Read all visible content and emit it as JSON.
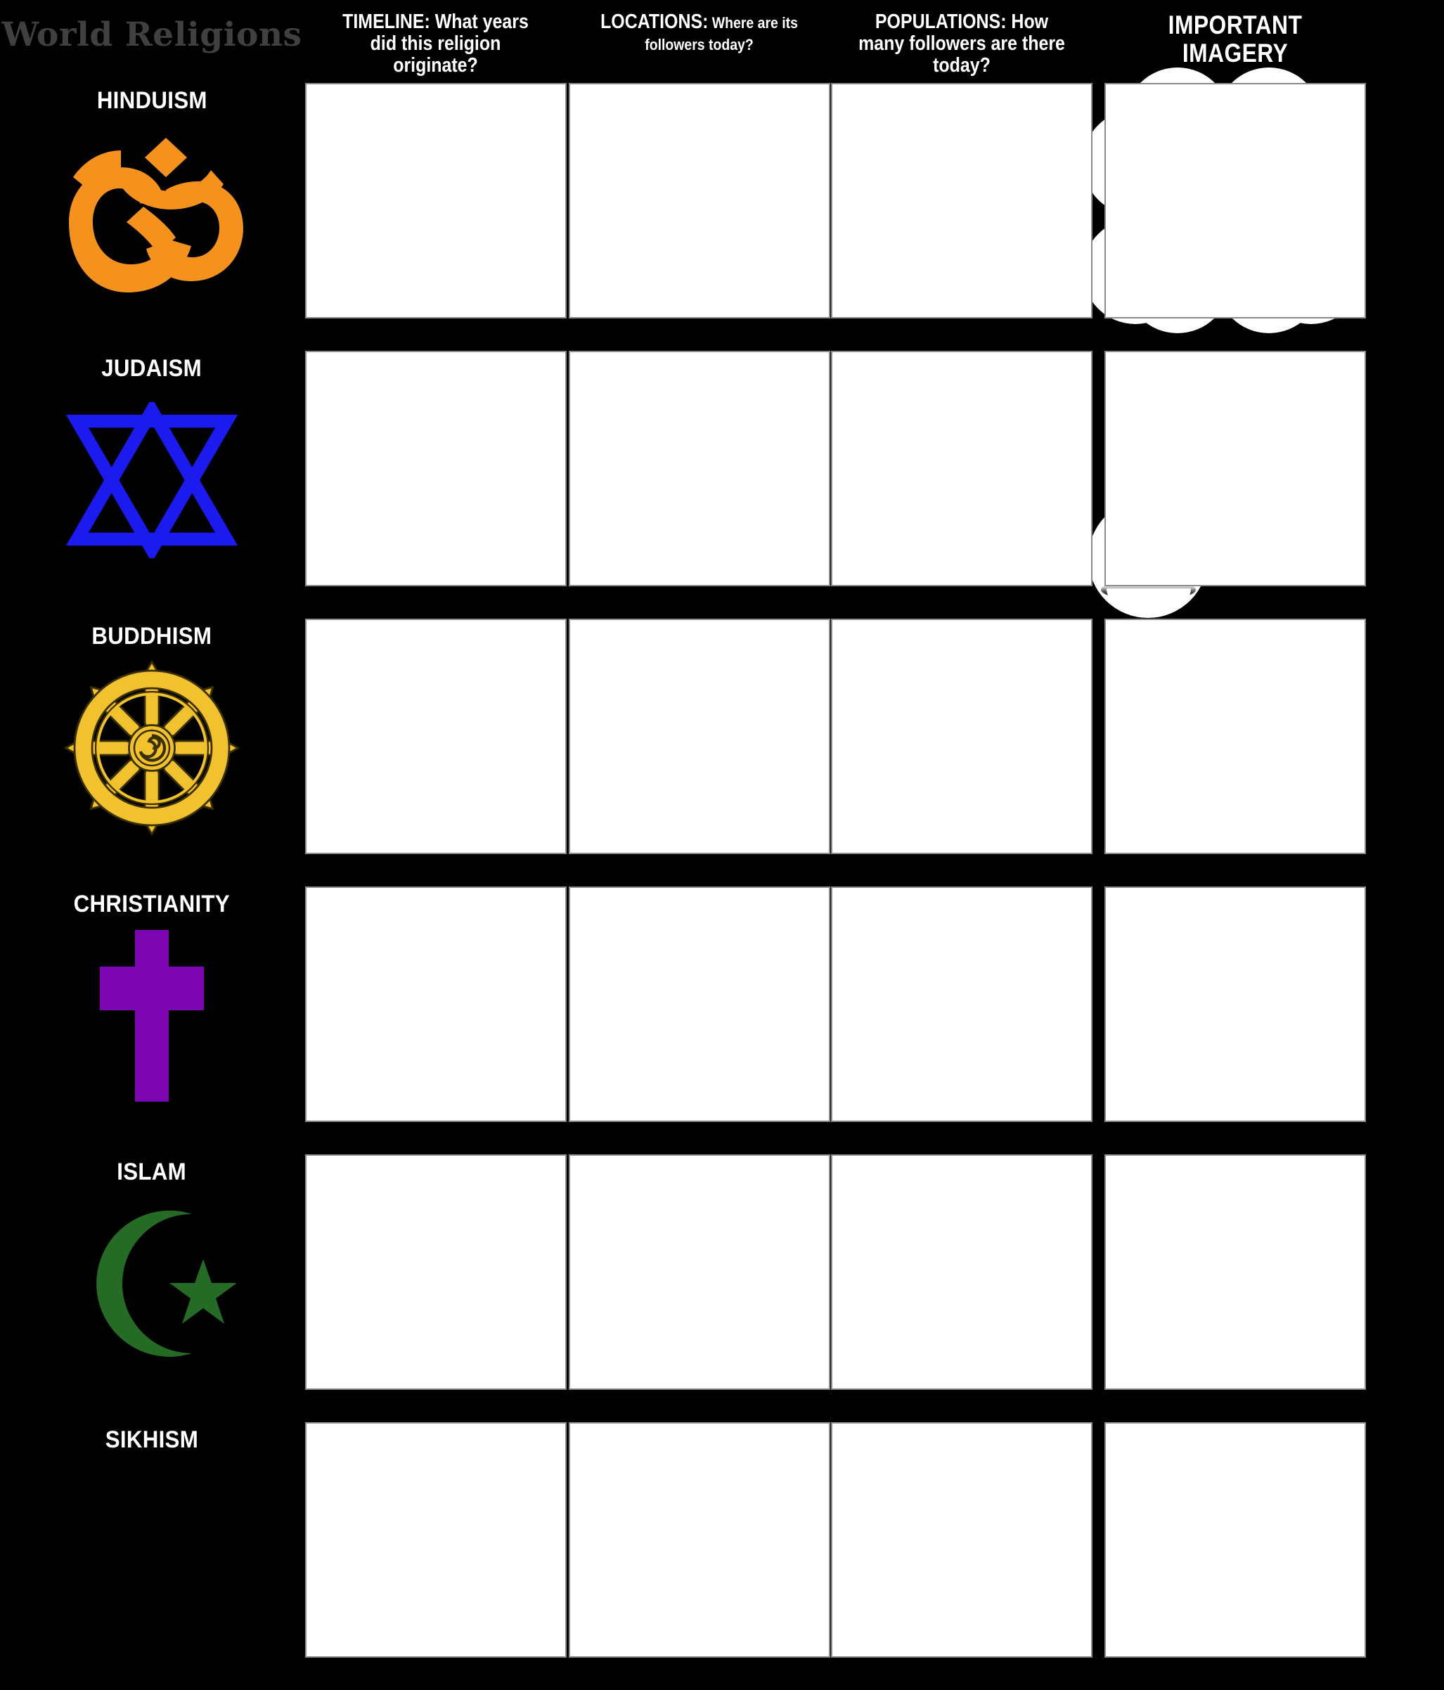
{
  "board": {
    "title": "World Religions",
    "title_color": "#3f403f",
    "background": "#000000",
    "cell_fill": "#ffffff",
    "cell_border": "#8c8c8c"
  },
  "columns": [
    {
      "id": "timeline",
      "lead": "TIMELINE:",
      "tail": " What years did this religion originate?"
    },
    {
      "id": "locations",
      "lead": "LOCATIONS:",
      "tail": " Where are its followers today?"
    },
    {
      "id": "populations",
      "lead": "POPULATIONS:",
      "tail": " How many followers are there today?"
    },
    {
      "id": "imagery",
      "lead": "IMPORTANT IMAGERY",
      "tail": ""
    }
  ],
  "rows": [
    {
      "id": "hinduism",
      "label": "HINDUISM",
      "icon": "om-icon",
      "icon_color": "#F5921E"
    },
    {
      "id": "judaism",
      "label": "JUDAISM",
      "icon": "star-of-david-icon",
      "icon_color": "#1B1BF0"
    },
    {
      "id": "buddhism",
      "label": "BUDDHISM",
      "icon": "dharma-wheel-icon",
      "icon_color": "#F2C12E"
    },
    {
      "id": "christianity",
      "label": "CHRISTIANITY",
      "icon": "cross-icon",
      "icon_color": "#7B06B2"
    },
    {
      "id": "islam",
      "label": "ISLAM",
      "icon": "star-and-crescent-icon",
      "icon_color": "#256B26"
    },
    {
      "id": "sikhism",
      "label": "SIKHISM",
      "icon": "",
      "icon_color": ""
    }
  ],
  "cells": [
    {
      "row": "hinduism",
      "timeline": "",
      "locations": "",
      "populations": "",
      "imagery": ""
    },
    {
      "row": "judaism",
      "timeline": "",
      "locations": "",
      "populations": "",
      "imagery": ""
    },
    {
      "row": "buddhism",
      "timeline": "",
      "locations": "",
      "populations": "",
      "imagery": ""
    },
    {
      "row": "christianity",
      "timeline": "",
      "locations": "",
      "populations": "",
      "imagery": ""
    },
    {
      "row": "islam",
      "timeline": "",
      "locations": "",
      "populations": "",
      "imagery": ""
    },
    {
      "row": "sikhism",
      "timeline": "",
      "locations": "",
      "populations": "",
      "imagery": ""
    }
  ]
}
